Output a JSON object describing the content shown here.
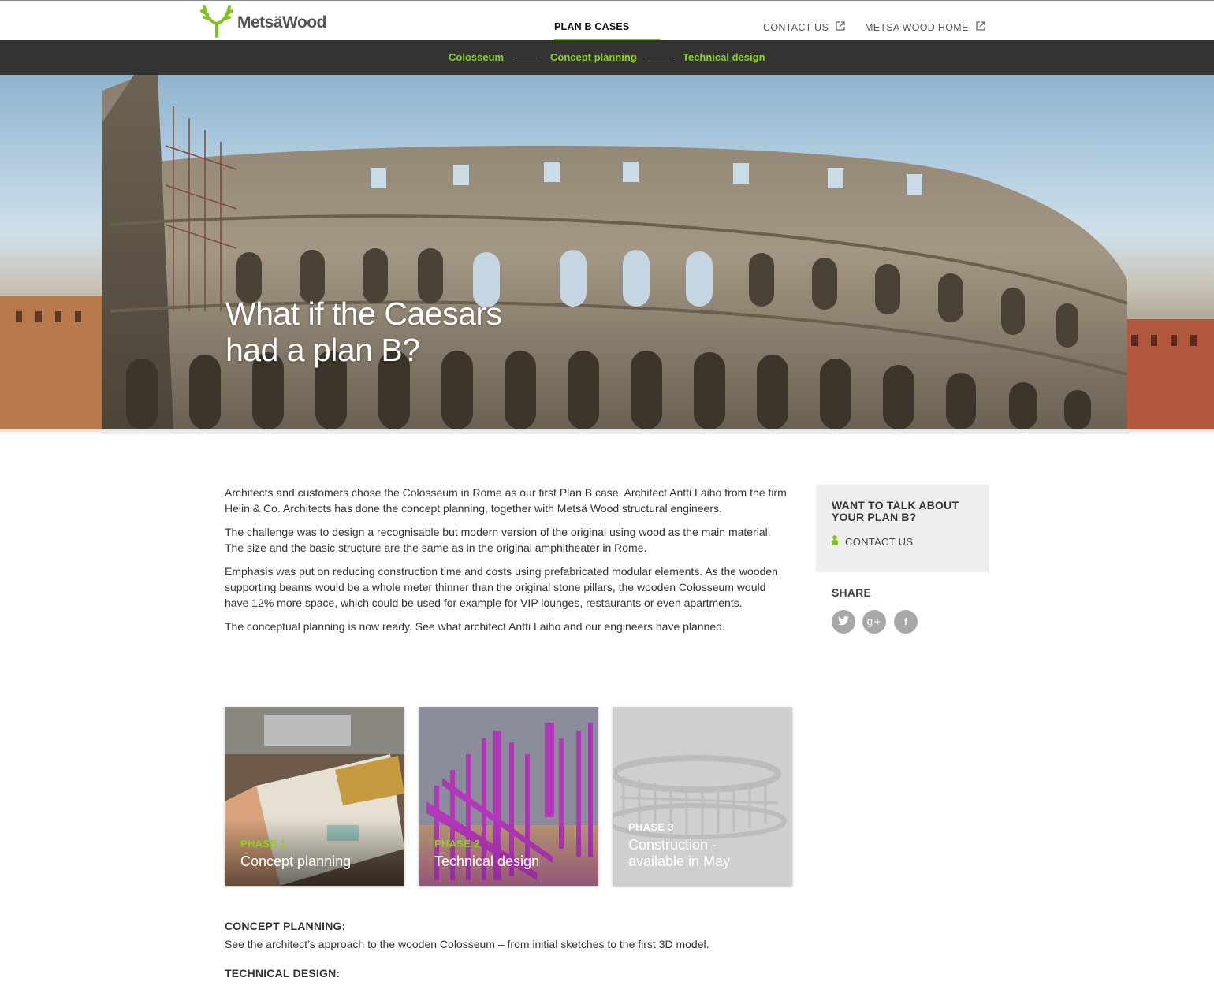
{
  "header": {
    "logo_text": "MetsäWood",
    "nav_active": "PLAN B CASES",
    "nav_links": [
      {
        "label": "CONTACT US",
        "icon": "external-link-icon"
      },
      {
        "label": "METSA WOOD HOME",
        "icon": "external-link-icon"
      }
    ]
  },
  "subnav": {
    "items": [
      "Colosseum",
      "Concept planning",
      "Technical design"
    ]
  },
  "hero": {
    "title_line1": "What if the Caesars",
    "title_line2": "had a plan B?"
  },
  "article": {
    "paragraphs": [
      "Architects and customers chose the Colosseum in Rome as our first Plan B case. Architect Antti Laiho from the firm Helin & Co. Architects has done the concept planning, together with Metsä Wood structural engineers.",
      "The challenge was to design a recognisable but modern version of the original using wood as the main material. The size and the basic structure are the same as in the original amphitheater in Rome.",
      "Emphasis was put on reducing construction time and costs using prefabricated modular elements. As the wooden supporting beams would be a whole meter thinner than the original stone pillars, the wooden Colosseum would have 12% more space, which could be used for example for VIP lounges, restaurants or even apartments.",
      "The conceptual planning is now ready. See what architect Antti Laiho and our engineers have planned."
    ]
  },
  "sidebar": {
    "talk_title": "WANT TO TALK ABOUT YOUR PLAN B?",
    "contact_label": "CONTACT US",
    "share_title": "SHARE",
    "social": [
      {
        "icon": "twitter-icon",
        "glyph": "t"
      },
      {
        "icon": "google-plus-icon",
        "glyph": "g+"
      },
      {
        "icon": "facebook-icon",
        "glyph": "f"
      }
    ]
  },
  "cards": [
    {
      "phase": "PHASE 1",
      "title": "Concept planning"
    },
    {
      "phase": "PHASE 2",
      "title": "Technical design"
    },
    {
      "phase": "PHASE 3",
      "title_line1": "Construction -",
      "title_line2": "available in May"
    }
  ],
  "sections": [
    {
      "heading": "CONCEPT PLANNING:",
      "text": "See the architect’s approach to the wooden Colosseum – from initial sketches to the first 3D model."
    },
    {
      "heading": "TECHNICAL DESIGN:",
      "text": ""
    }
  ],
  "colors": {
    "accent_green": "#7fc31c",
    "subnav_bg": "#333333",
    "sidebar_bg": "#eeeeee",
    "social_grey": "#a8a8a8"
  }
}
